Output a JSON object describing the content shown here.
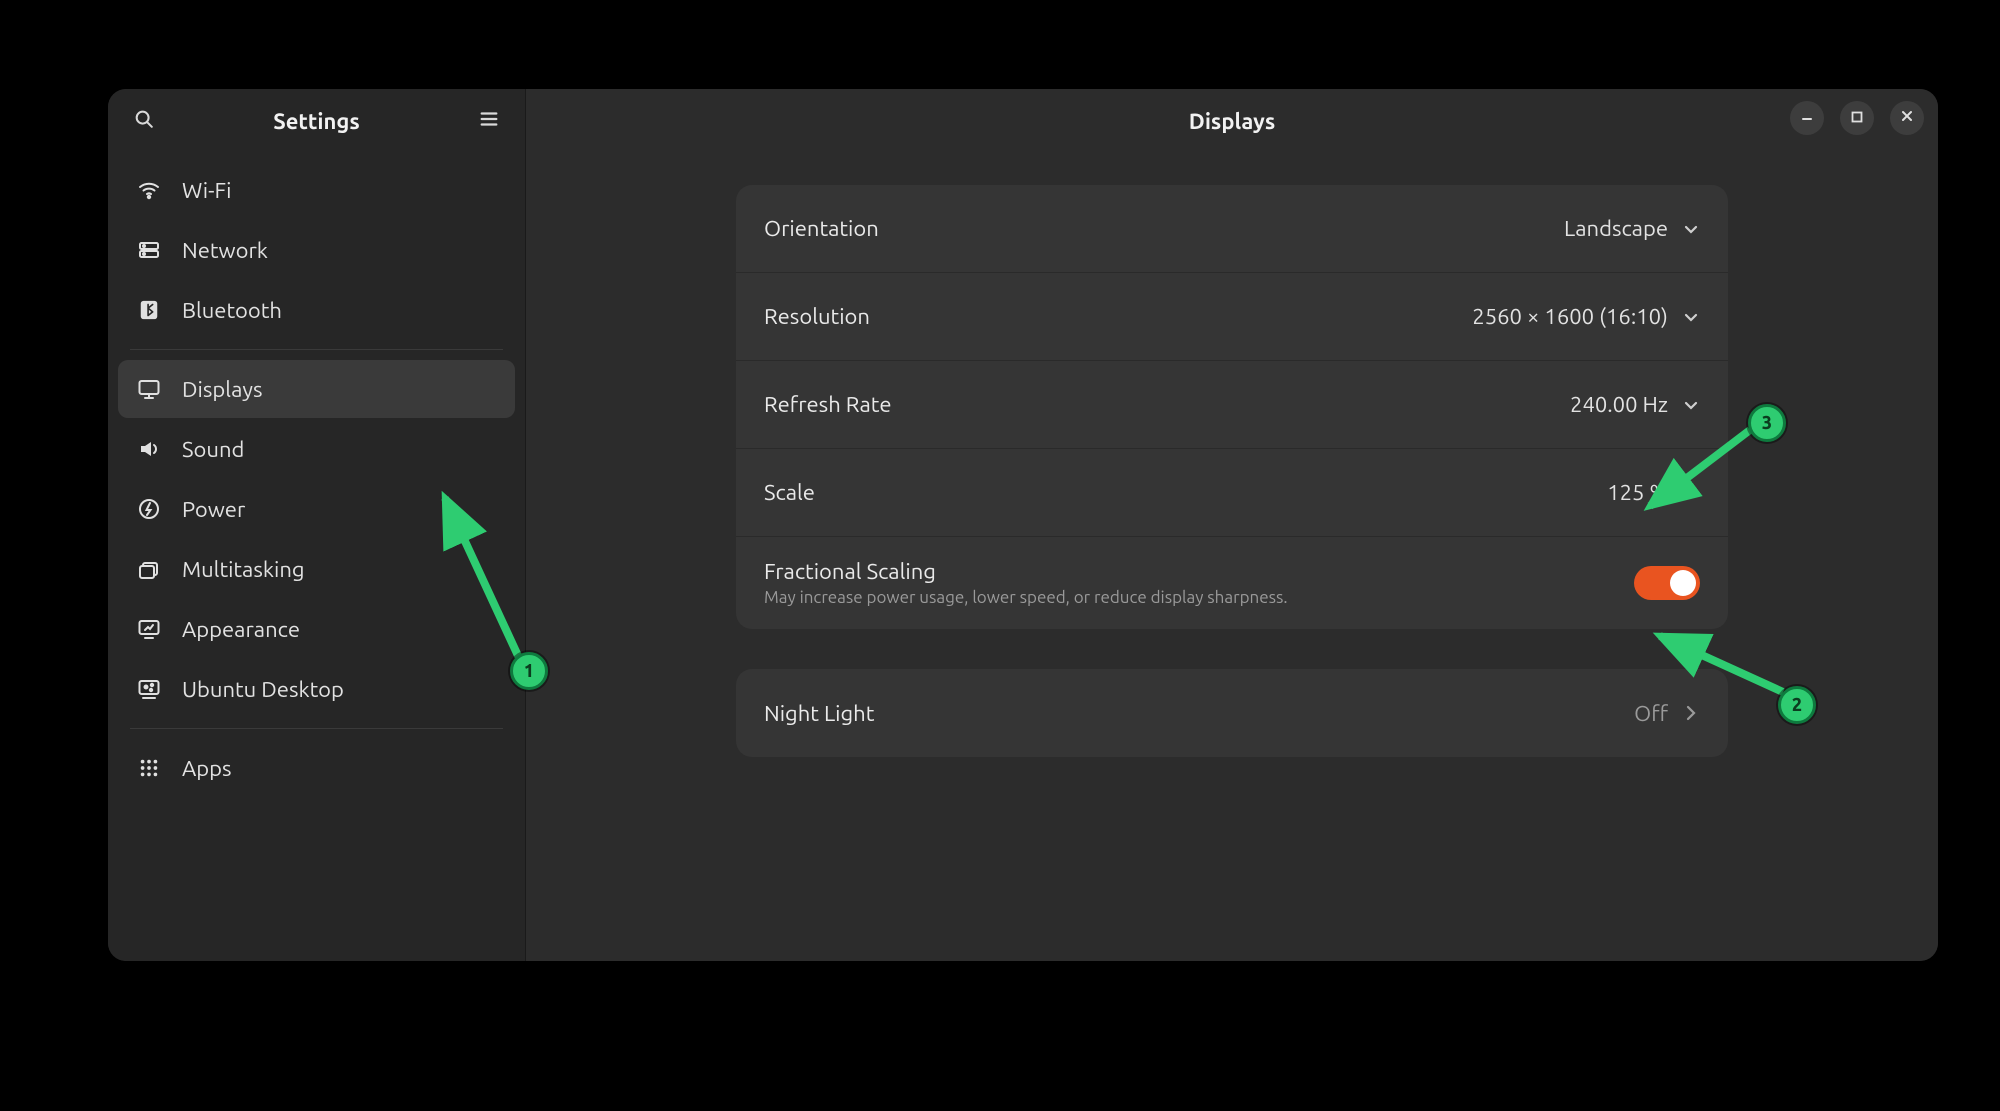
{
  "sidebar": {
    "title": "Settings",
    "items": [
      {
        "id": "wifi",
        "label": "Wi-Fi"
      },
      {
        "id": "network",
        "label": "Network"
      },
      {
        "id": "bluetooth",
        "label": "Bluetooth"
      },
      {
        "id": "displays",
        "label": "Displays",
        "active": true
      },
      {
        "id": "sound",
        "label": "Sound"
      },
      {
        "id": "power",
        "label": "Power"
      },
      {
        "id": "multitasking",
        "label": "Multitasking"
      },
      {
        "id": "appearance",
        "label": "Appearance"
      },
      {
        "id": "ubuntu",
        "label": "Ubuntu Desktop"
      },
      {
        "id": "apps",
        "label": "Apps"
      }
    ]
  },
  "main": {
    "title": "Displays",
    "rows": {
      "orientation": {
        "label": "Orientation",
        "value": "Landscape"
      },
      "resolution": {
        "label": "Resolution",
        "value": "2560 × 1600 (16:10)"
      },
      "refresh_rate": {
        "label": "Refresh Rate",
        "value": "240.00 Hz"
      },
      "scale": {
        "label": "Scale",
        "value": "125 %"
      },
      "fractional": {
        "label": "Fractional Scaling",
        "sub": "May increase power usage, lower speed, or reduce display sharpness.",
        "on": true
      },
      "night_light": {
        "label": "Night Light",
        "value": "Off"
      }
    }
  },
  "annotations": {
    "badges": {
      "1": "1",
      "2": "2",
      "3": "3"
    }
  },
  "colors": {
    "accent": "#e95420",
    "annotation": "#2ecc71"
  }
}
